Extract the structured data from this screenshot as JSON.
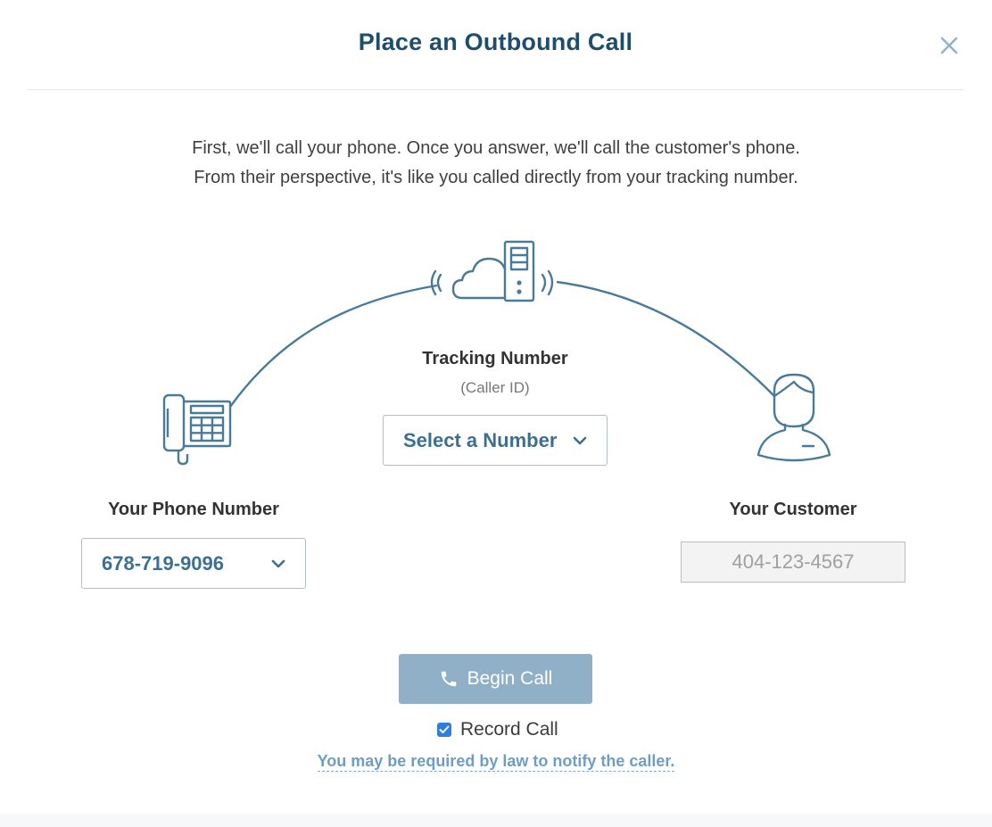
{
  "dialog": {
    "title": "Place an Outbound Call",
    "close_icon": "close-icon"
  },
  "intro": {
    "line1": "First, we'll call your phone. Once you answer, we'll call the customer's phone.",
    "line2": "From their perspective, it's like you called directly from your tracking number."
  },
  "tracking": {
    "label": "Tracking Number",
    "sublabel": "(Caller ID)",
    "select_value": "Select a Number",
    "icon": "cloud-server-icon"
  },
  "your_phone": {
    "label": "Your Phone Number",
    "select_value": "678-719-9096",
    "icon": "desk-phone-icon"
  },
  "customer": {
    "label": "Your Customer",
    "placeholder": "404-123-4567",
    "icon": "customer-avatar-icon"
  },
  "actions": {
    "begin_call": "Begin Call",
    "record_call": "Record Call",
    "record_checked": true,
    "law_notice": "You may be required by law to notify the caller."
  },
  "colors": {
    "title": "#1f4e6b",
    "icon_stroke": "#4a7a99",
    "button_bg": "#8fb0c6",
    "checkbox": "#2f7de1",
    "link": "#6f9dc3"
  }
}
